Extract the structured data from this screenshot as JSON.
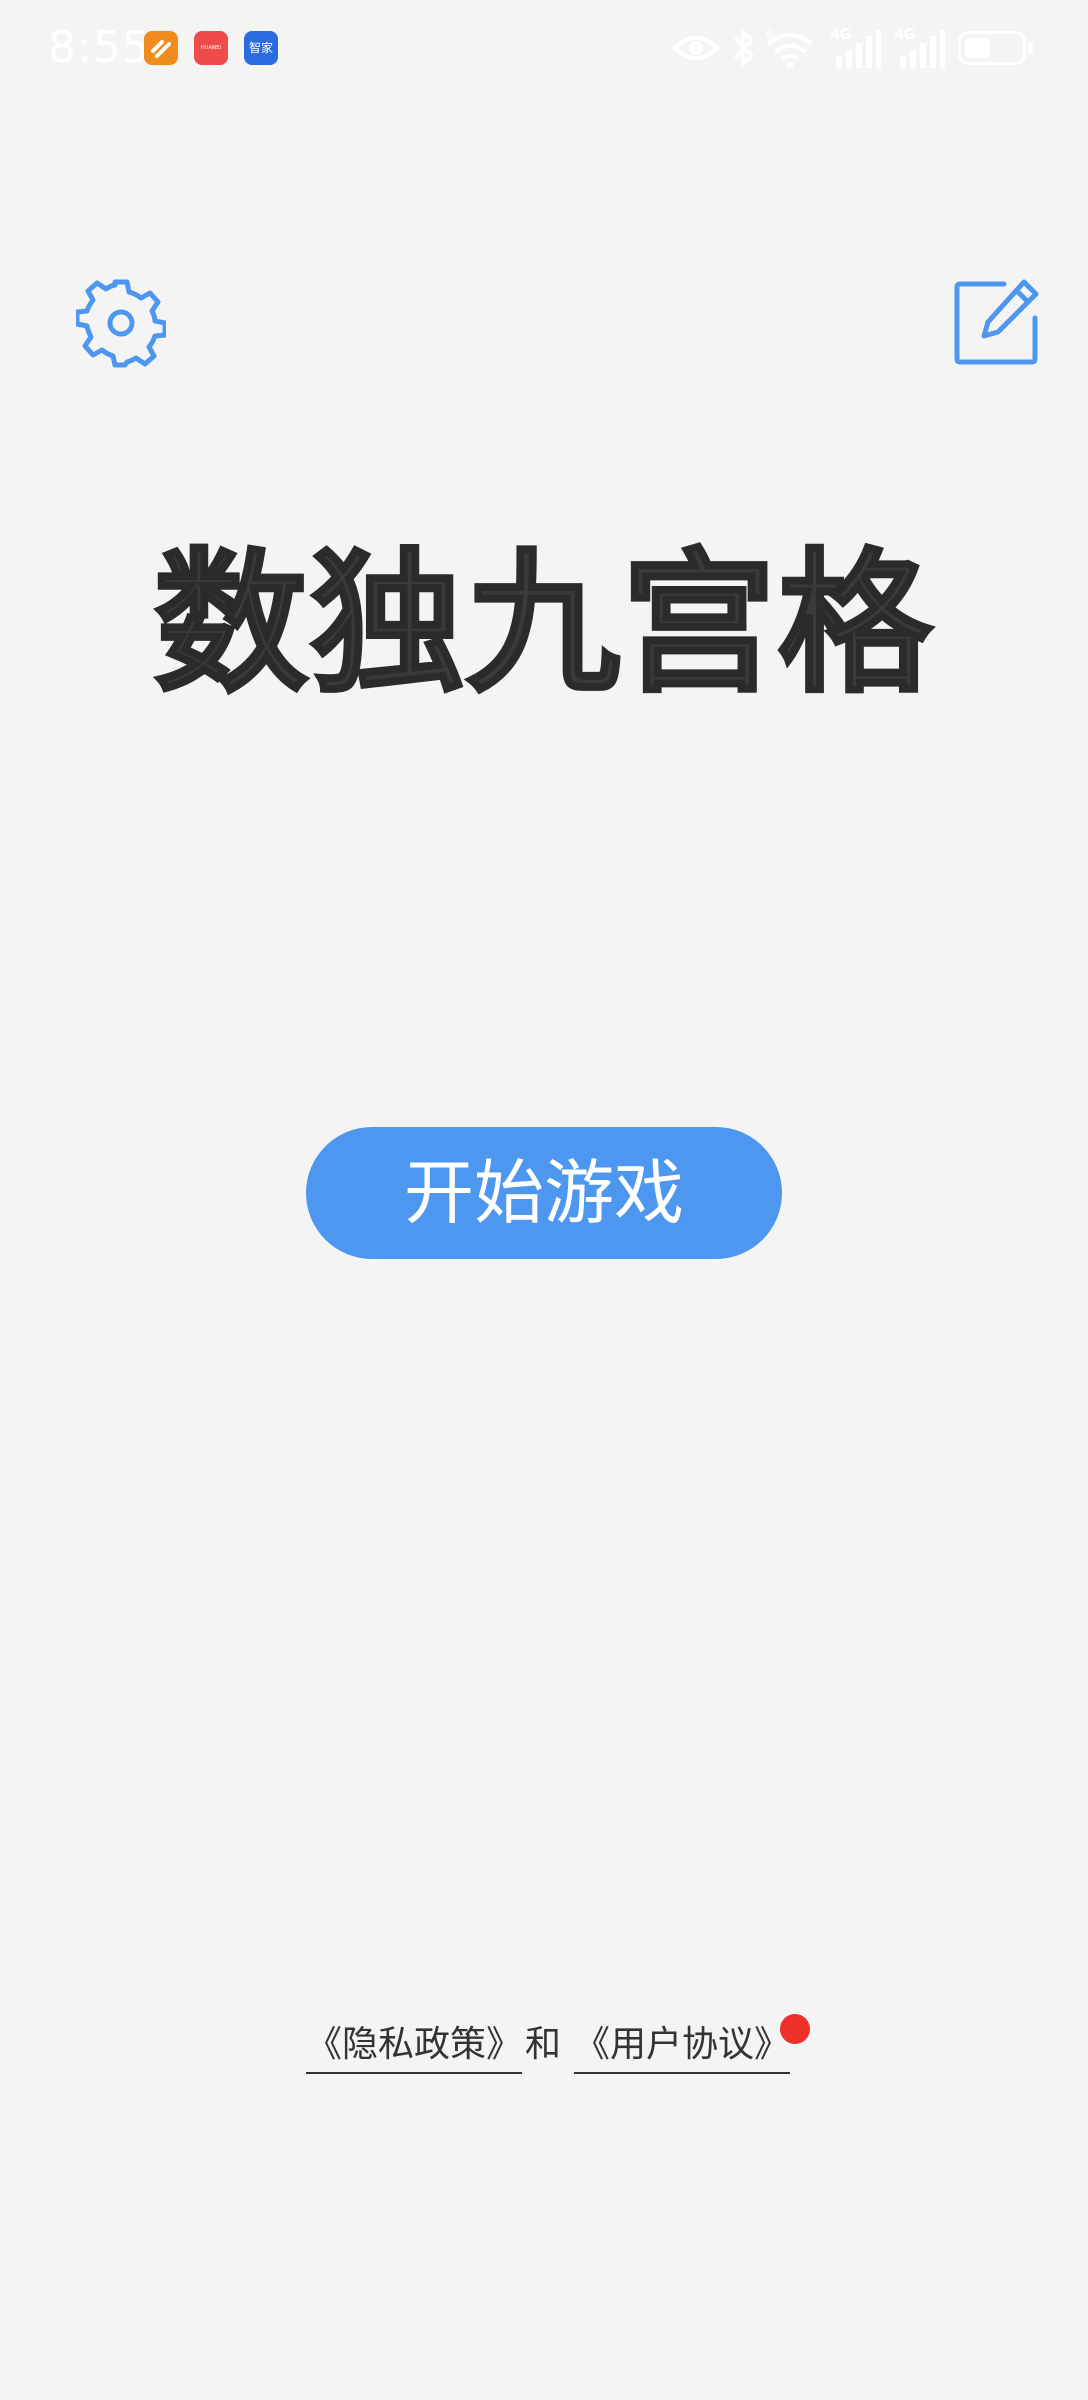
{
  "status_bar": {
    "time": "8:55",
    "notifications": [
      {
        "name": "app-notification-icon",
        "label": ""
      },
      {
        "name": "huawei-notification-icon",
        "label": "HUAWEI"
      },
      {
        "name": "zhijia-notification-icon",
        "label": "智家"
      }
    ],
    "network_label_1": "4G",
    "network_label_2": "4G",
    "wifi_label": "6",
    "battery_level_percent": 45
  },
  "toolbar": {
    "settings_icon": "gear-icon",
    "edit_icon": "edit-note-icon",
    "accent_color": "#4d97f0"
  },
  "main": {
    "title": "数独九宫格",
    "start_button_label": "开始游戏"
  },
  "footer": {
    "privacy_link": "《隐私政策》",
    "and_text": "和",
    "agreement_link": "《用户协议》",
    "badge_color": "#f0302a"
  }
}
